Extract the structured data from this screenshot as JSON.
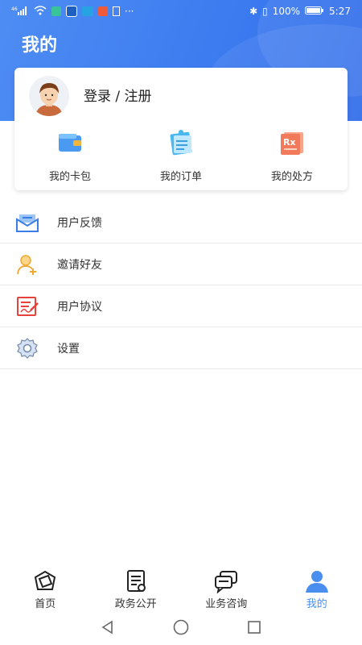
{
  "status": {
    "carrier": "⁴⁶",
    "battery": "100%",
    "time": "5:27"
  },
  "header": {
    "title": "我的"
  },
  "profile": {
    "login_text": "登录 / 注册"
  },
  "quick_actions": [
    {
      "label": "我的卡包",
      "icon": "wallet-icon"
    },
    {
      "label": "我的订单",
      "icon": "clipboard-icon"
    },
    {
      "label": "我的处方",
      "icon": "prescription-icon"
    }
  ],
  "menu": [
    {
      "label": "用户反馈",
      "icon": "feedback-mail-icon"
    },
    {
      "label": "邀请好友",
      "icon": "invite-user-icon"
    },
    {
      "label": "用户协议",
      "icon": "agreement-icon"
    },
    {
      "label": "设置",
      "icon": "gear-icon"
    }
  ],
  "tabs": [
    {
      "label": "首页",
      "icon": "home-icon",
      "active": false
    },
    {
      "label": "政务公开",
      "icon": "document-icon",
      "active": false
    },
    {
      "label": "业务咨询",
      "icon": "chat-icon",
      "active": false
    },
    {
      "label": "我的",
      "icon": "user-icon",
      "active": true
    }
  ],
  "colors": {
    "primary": "#3d7cf0",
    "active_tab": "#4a8ff0",
    "text": "#333333"
  }
}
